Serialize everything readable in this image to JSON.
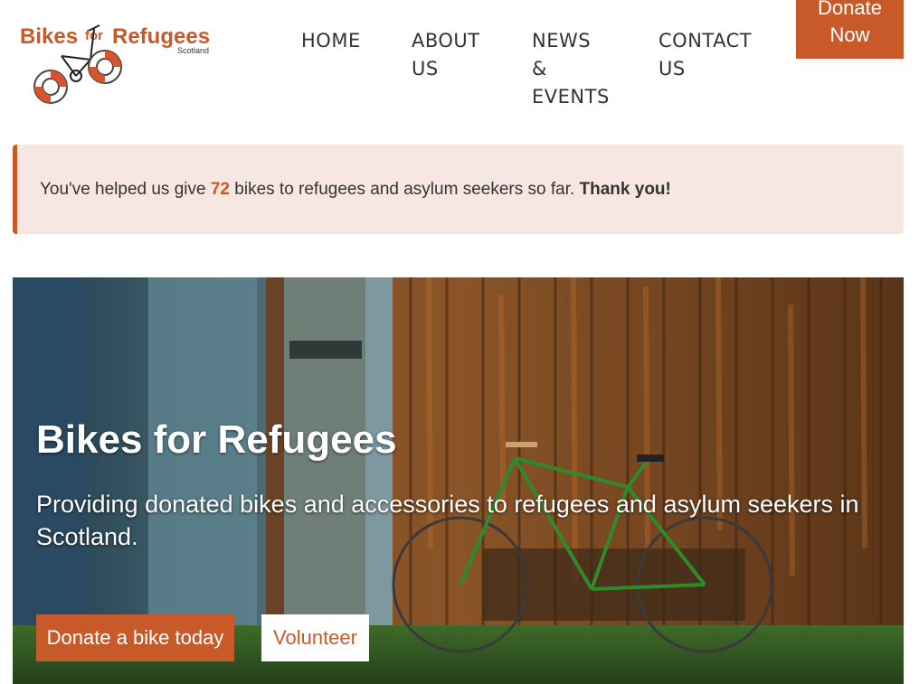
{
  "logo": {
    "text_bikes": "Bikes",
    "text_for": "for",
    "text_refugees": "Refugees",
    "text_scotland": "Scotland"
  },
  "nav": {
    "home": [
      "HOME"
    ],
    "about": [
      "ABOUT",
      "US"
    ],
    "news": [
      "NEWS",
      "&",
      "EVENTS"
    ],
    "contact": [
      "CONTACT",
      "US"
    ]
  },
  "donate_now": [
    "Donate",
    "Now"
  ],
  "banner": {
    "prefix": "You've helped us give ",
    "count": "72",
    "suffix": " bikes to refugees and asylum seekers so far. ",
    "thanks": "Thank you!"
  },
  "hero": {
    "title": "Bikes for Refugees",
    "subtitle": "Providing donated bikes and accessories to refugees and asylum seekers in Scotland.",
    "primary_button": "Donate a bike today",
    "secondary_button": "Volunteer"
  },
  "colors": {
    "accent": "#c85a2a",
    "banner_bg": "#f7e7e2",
    "text": "#333333"
  }
}
